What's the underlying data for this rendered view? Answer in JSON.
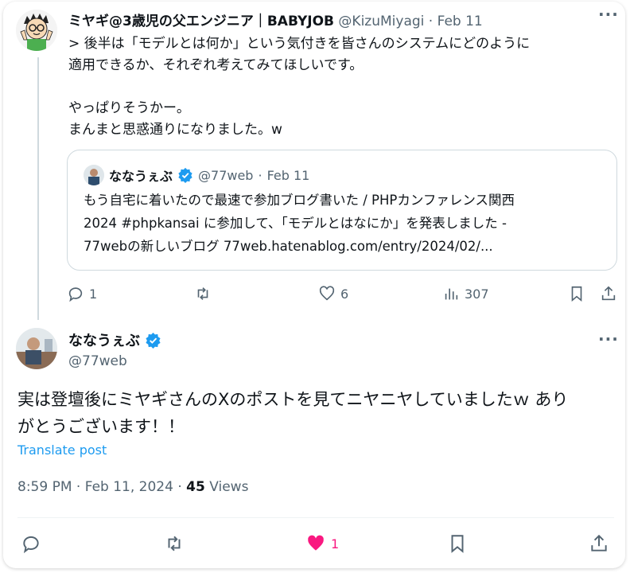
{
  "reply_post": {
    "display_name": "ミヤギ@3歳児の父エンジニア｜BABYJOB",
    "handle": "@KizuMiyagi",
    "date": "Feb 11",
    "text": "> 後半は「モデルとは何か」という気付きを皆さんのシステムにどのように\n適用できるか、それぞれ考えてみてほしいです。\n\nやっぱりそうかー。\nまんまと思惑通りになりました。w",
    "quote": {
      "display_name": "ななうぇぶ",
      "handle": "@77web",
      "date": "Feb 11",
      "text": "もう自宅に着いたので最速で参加ブログ書いた / PHPカンファレンス関西\n2024 #phpkansai に参加して、「モデルとはなにか」を発表しました -\n77webの新しいブログ 77web.hatenablog.com/entry/2024/02/..."
    },
    "actions": {
      "replies": "1",
      "likes": "6",
      "views": "307"
    }
  },
  "main_post": {
    "display_name": "ななうぇぶ",
    "handle": "@77web",
    "text": "実は登壇後にミヤギさんのXのポストを見てニヤニヤしていましたｗ あり\nがとうございます！！",
    "translate_label": "Translate post",
    "time": "8:59 PM",
    "date": "Feb 11, 2024",
    "views_count": "45",
    "views_label": "Views",
    "likes": "1"
  },
  "icons": [
    "reply-icon",
    "retweet-icon",
    "like-icon",
    "views-icon",
    "bookmark-icon",
    "share-icon",
    "more-icon",
    "verified-icon"
  ],
  "colors": {
    "accent": "#1d9bf0",
    "like": "#f91880",
    "muted": "#536471"
  }
}
